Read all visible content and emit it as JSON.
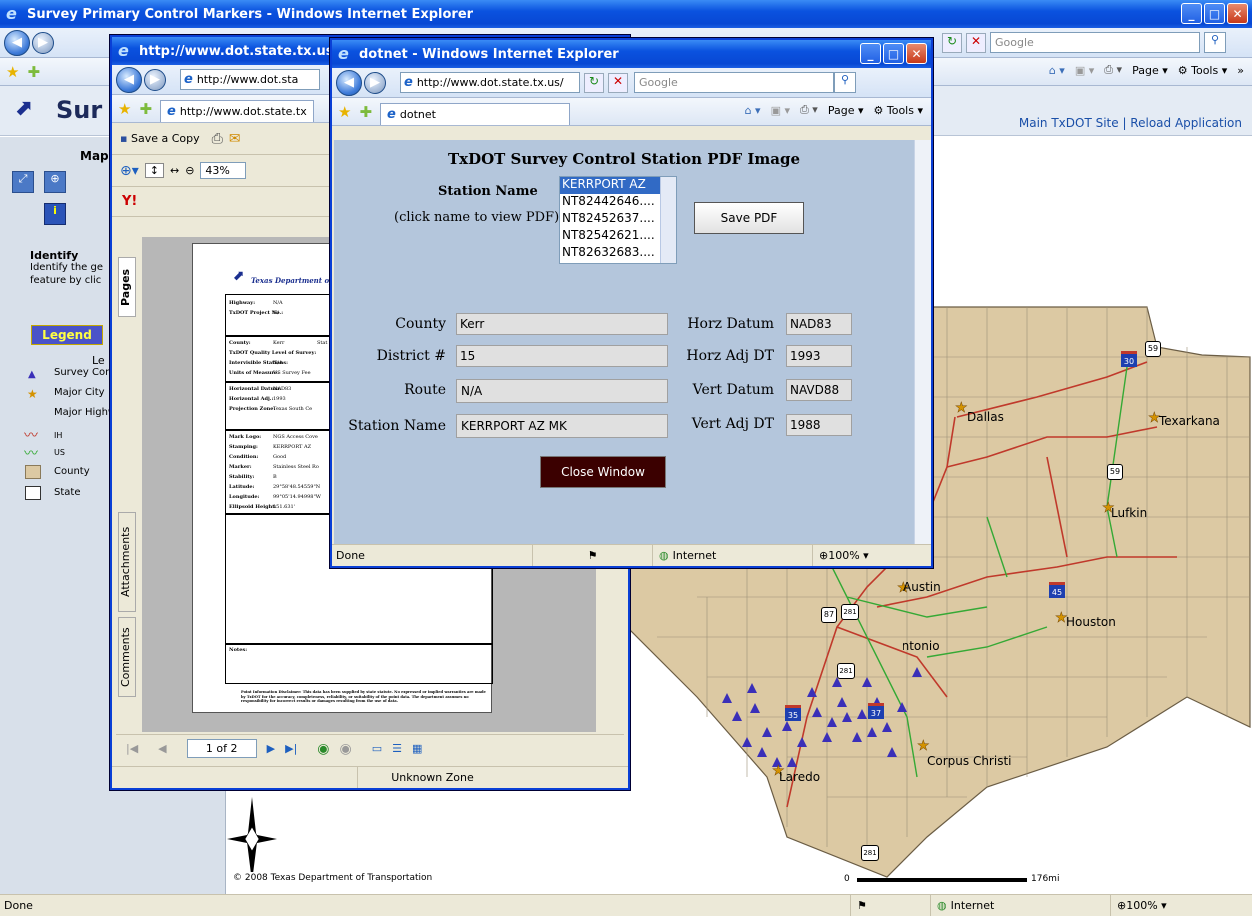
{
  "main_window": {
    "title": "Survey Primary Control Markers - Windows Internet Explorer",
    "search_placeholder": "Google",
    "command_bar": {
      "page": "Page",
      "tools": "Tools"
    },
    "status": {
      "left": "Done",
      "zone": "Internet",
      "zoom": "100%"
    }
  },
  "app": {
    "title_partial": "Sur",
    "links": "Main TxDOT Site | Reload Application",
    "map_tools_title": "Map I",
    "identify": {
      "title": "Identify",
      "desc1": "Identify the ge",
      "desc2": "feature by clic"
    },
    "legend_button": "Legend",
    "legend_title": "Le",
    "legend_items": [
      "Survey Con",
      "Major City",
      "Major Highw",
      "IH",
      "US",
      "County",
      "State"
    ],
    "copyright": "© 2008 Texas Department of Transportation",
    "scale": {
      "start": "0",
      "end": "176mi"
    }
  },
  "map": {
    "cities": [
      "Texarkana",
      "Dallas",
      "Lufkin",
      "Austin",
      "Houston",
      "San Antonio",
      "Corpus Christi",
      "Laredo"
    ],
    "shields": [
      "30",
      "59",
      "59",
      "45",
      "87",
      "281",
      "281",
      "35",
      "37",
      "281"
    ]
  },
  "pdf_window": {
    "title": "http://www.dot.state.tx.us/g",
    "address": "http://www.dot.sta",
    "tab_label": "http://www.dot.state.tx",
    "toolbar": {
      "save_copy": "Save a Copy",
      "zoom": "43%",
      "yahoo": "Y!"
    },
    "side_tabs": [
      "Pages",
      "Attachments",
      "Comments"
    ],
    "page_nav": "1 of 2",
    "status_zone": "Unknown Zone",
    "doc": {
      "header": "Texas Department of",
      "rows_a": [
        [
          "Highway:",
          "N/A"
        ],
        [
          "TxDOT Project No.:",
          "N/"
        ]
      ],
      "rows_b": [
        [
          "County:",
          "Kerr",
          "Stat"
        ],
        [
          "TxDOT Quality Level of Survey:",
          ""
        ],
        [
          "Intervisible Stations:",
          "N/A"
        ],
        [
          "Units of Measure:",
          "US Survey Fee"
        ]
      ],
      "rows_c": [
        [
          "Horizontal Datum:",
          "NAD83"
        ],
        [
          "Horizontal Adj.:",
          "1993"
        ],
        [
          "Projection Zone:",
          "Texas South Ce"
        ]
      ],
      "rows_d": [
        [
          "Mark Logo:",
          "NGS Access Cove"
        ],
        [
          "Stamping:",
          "KERRPORT AZ"
        ],
        [
          "Condition:",
          "Good"
        ],
        [
          "Marker:",
          "Stainless Steel Ro"
        ],
        [
          "Stability:",
          "B"
        ],
        [
          "Latitude:",
          "29°58'48.54559\"N"
        ],
        [
          "Longitude:",
          "99°05'14.94998\"W"
        ],
        [
          "Ellipsoid Height:",
          "151.631'"
        ]
      ],
      "notes": "Notes:",
      "disclaimer": "Point Information Disclaimer: This data has been supplied by state statute. No expressed or implied warranties are made by TxDOT for the accuracy, completeness, reliability, or suitability of the point data. The department assumes no responsibility for incorrect results or damages resulting from the use of data."
    }
  },
  "dotnet_window": {
    "title": "dotnet - Windows Internet Explorer",
    "address": "http://www.dot.state.tx.us/",
    "search_placeholder": "Google",
    "tab_label": "dotnet",
    "command_bar": {
      "page": "Page",
      "tools": "Tools"
    },
    "heading": "TxDOT Survey Control Station PDF Image",
    "station_name_label": "Station Name",
    "click_hint": "(click name to view PDF)",
    "stations": [
      "KERRPORT AZ",
      "NT82442646....",
      "NT82452637....",
      "NT82542621....",
      "NT82632683...."
    ],
    "save_pdf": "Save PDF",
    "fields": {
      "county": {
        "label": "County",
        "value": "Kerr"
      },
      "district": {
        "label": "District #",
        "value": "15"
      },
      "route": {
        "label": "Route",
        "value": "N/A"
      },
      "station": {
        "label": "Station Name",
        "value": "KERRPORT AZ MK"
      },
      "horz_datum": {
        "label": "Horz Datum",
        "value": "NAD83"
      },
      "horz_adj": {
        "label": "Horz Adj DT",
        "value": "1993"
      },
      "vert_datum": {
        "label": "Vert Datum",
        "value": "NAVD88"
      },
      "vert_adj": {
        "label": "Vert Adj DT",
        "value": "1988"
      }
    },
    "close_window": "Close Window",
    "status": {
      "left": "Done",
      "zone": "Internet",
      "zoom": "100%"
    }
  },
  "colors": {
    "xp_title": "#0a52df",
    "map_land": "#dcc9a3",
    "county_line": "#9c8f78",
    "ih": "#c0392b",
    "us": "#35a935",
    "marker": "#3a2fb8",
    "close_btn": "#3b0000",
    "form_bg": "#b4c6dc"
  }
}
